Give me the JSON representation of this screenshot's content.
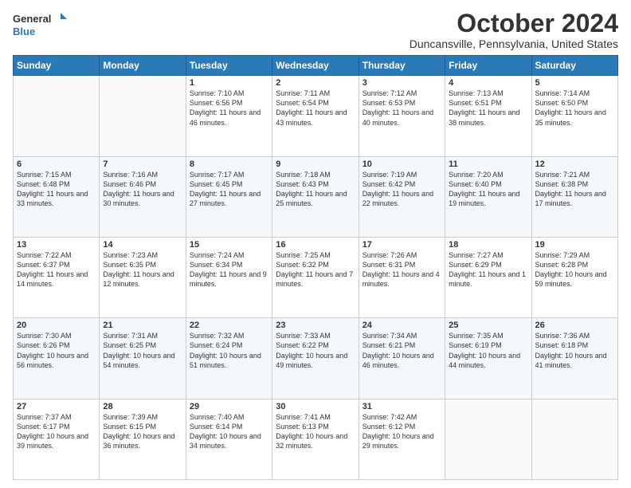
{
  "logo": {
    "line1": "General",
    "line2": "Blue"
  },
  "title": "October 2024",
  "subtitle": "Duncansville, Pennsylvania, United States",
  "weekdays": [
    "Sunday",
    "Monday",
    "Tuesday",
    "Wednesday",
    "Thursday",
    "Friday",
    "Saturday"
  ],
  "weeks": [
    [
      null,
      null,
      {
        "day": 1,
        "rise": "7:10 AM",
        "set": "6:56 PM",
        "daylight": "11 hours and 46 minutes."
      },
      {
        "day": 2,
        "rise": "7:11 AM",
        "set": "6:54 PM",
        "daylight": "11 hours and 43 minutes."
      },
      {
        "day": 3,
        "rise": "7:12 AM",
        "set": "6:53 PM",
        "daylight": "11 hours and 40 minutes."
      },
      {
        "day": 4,
        "rise": "7:13 AM",
        "set": "6:51 PM",
        "daylight": "11 hours and 38 minutes."
      },
      {
        "day": 5,
        "rise": "7:14 AM",
        "set": "6:50 PM",
        "daylight": "11 hours and 35 minutes."
      }
    ],
    [
      {
        "day": 6,
        "rise": "7:15 AM",
        "set": "6:48 PM",
        "daylight": "11 hours and 33 minutes."
      },
      {
        "day": 7,
        "rise": "7:16 AM",
        "set": "6:46 PM",
        "daylight": "11 hours and 30 minutes."
      },
      {
        "day": 8,
        "rise": "7:17 AM",
        "set": "6:45 PM",
        "daylight": "11 hours and 27 minutes."
      },
      {
        "day": 9,
        "rise": "7:18 AM",
        "set": "6:43 PM",
        "daylight": "11 hours and 25 minutes."
      },
      {
        "day": 10,
        "rise": "7:19 AM",
        "set": "6:42 PM",
        "daylight": "11 hours and 22 minutes."
      },
      {
        "day": 11,
        "rise": "7:20 AM",
        "set": "6:40 PM",
        "daylight": "11 hours and 19 minutes."
      },
      {
        "day": 12,
        "rise": "7:21 AM",
        "set": "6:38 PM",
        "daylight": "11 hours and 17 minutes."
      }
    ],
    [
      {
        "day": 13,
        "rise": "7:22 AM",
        "set": "6:37 PM",
        "daylight": "11 hours and 14 minutes."
      },
      {
        "day": 14,
        "rise": "7:23 AM",
        "set": "6:35 PM",
        "daylight": "11 hours and 12 minutes."
      },
      {
        "day": 15,
        "rise": "7:24 AM",
        "set": "6:34 PM",
        "daylight": "11 hours and 9 minutes."
      },
      {
        "day": 16,
        "rise": "7:25 AM",
        "set": "6:32 PM",
        "daylight": "11 hours and 7 minutes."
      },
      {
        "day": 17,
        "rise": "7:26 AM",
        "set": "6:31 PM",
        "daylight": "11 hours and 4 minutes."
      },
      {
        "day": 18,
        "rise": "7:27 AM",
        "set": "6:29 PM",
        "daylight": "11 hours and 1 minute."
      },
      {
        "day": 19,
        "rise": "7:29 AM",
        "set": "6:28 PM",
        "daylight": "10 hours and 59 minutes."
      }
    ],
    [
      {
        "day": 20,
        "rise": "7:30 AM",
        "set": "6:26 PM",
        "daylight": "10 hours and 56 minutes."
      },
      {
        "day": 21,
        "rise": "7:31 AM",
        "set": "6:25 PM",
        "daylight": "10 hours and 54 minutes."
      },
      {
        "day": 22,
        "rise": "7:32 AM",
        "set": "6:24 PM",
        "daylight": "10 hours and 51 minutes."
      },
      {
        "day": 23,
        "rise": "7:33 AM",
        "set": "6:22 PM",
        "daylight": "10 hours and 49 minutes."
      },
      {
        "day": 24,
        "rise": "7:34 AM",
        "set": "6:21 PM",
        "daylight": "10 hours and 46 minutes."
      },
      {
        "day": 25,
        "rise": "7:35 AM",
        "set": "6:19 PM",
        "daylight": "10 hours and 44 minutes."
      },
      {
        "day": 26,
        "rise": "7:36 AM",
        "set": "6:18 PM",
        "daylight": "10 hours and 41 minutes."
      }
    ],
    [
      {
        "day": 27,
        "rise": "7:37 AM",
        "set": "6:17 PM",
        "daylight": "10 hours and 39 minutes."
      },
      {
        "day": 28,
        "rise": "7:39 AM",
        "set": "6:15 PM",
        "daylight": "10 hours and 36 minutes."
      },
      {
        "day": 29,
        "rise": "7:40 AM",
        "set": "6:14 PM",
        "daylight": "10 hours and 34 minutes."
      },
      {
        "day": 30,
        "rise": "7:41 AM",
        "set": "6:13 PM",
        "daylight": "10 hours and 32 minutes."
      },
      {
        "day": 31,
        "rise": "7:42 AM",
        "set": "6:12 PM",
        "daylight": "10 hours and 29 minutes."
      },
      null,
      null
    ]
  ]
}
